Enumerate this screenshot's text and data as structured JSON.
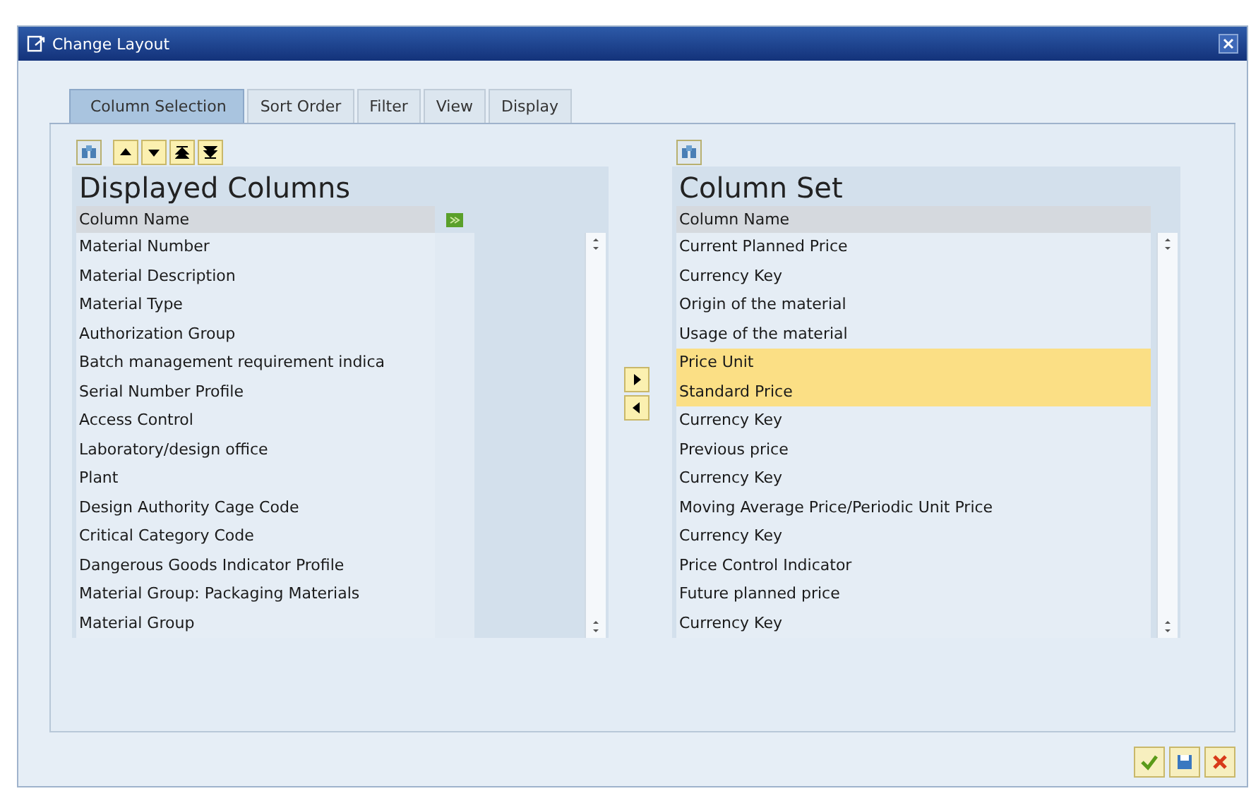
{
  "window": {
    "title": "Change Layout"
  },
  "tabs": [
    {
      "label": "Column Selection",
      "selected": true
    },
    {
      "label": "Sort Order",
      "selected": false
    },
    {
      "label": "Filter",
      "selected": false
    },
    {
      "label": "View",
      "selected": false
    },
    {
      "label": "Display",
      "selected": false
    }
  ],
  "displayed_columns": {
    "title": "Displayed Columns",
    "column_header": "Column Name",
    "rows": [
      {
        "label": "Material Number",
        "selected": false
      },
      {
        "label": "Material Description",
        "selected": false
      },
      {
        "label": "Material Type",
        "selected": false
      },
      {
        "label": "Authorization Group",
        "selected": false
      },
      {
        "label": "Batch management requirement indica",
        "selected": false
      },
      {
        "label": "Serial Number Profile",
        "selected": false
      },
      {
        "label": "Access Control",
        "selected": false
      },
      {
        "label": "Laboratory/design office",
        "selected": false
      },
      {
        "label": "Plant",
        "selected": false
      },
      {
        "label": "Design Authority Cage Code",
        "selected": false
      },
      {
        "label": "Critical Category Code",
        "selected": false
      },
      {
        "label": "Dangerous Goods Indicator Profile",
        "selected": false
      },
      {
        "label": "Material Group: Packaging Materials",
        "selected": false
      },
      {
        "label": "Material Group",
        "selected": false
      }
    ]
  },
  "column_set": {
    "title": "Column Set",
    "column_header": "Column Name",
    "rows": [
      {
        "label": "Current Planned Price",
        "selected": false
      },
      {
        "label": "Currency Key",
        "selected": false
      },
      {
        "label": "Origin of the material",
        "selected": false
      },
      {
        "label": "Usage of the material",
        "selected": false
      },
      {
        "label": "Price Unit",
        "selected": true
      },
      {
        "label": "Standard Price",
        "selected": true
      },
      {
        "label": "Currency Key",
        "selected": false
      },
      {
        "label": "Previous price",
        "selected": false
      },
      {
        "label": "Currency Key",
        "selected": false
      },
      {
        "label": "Moving Average Price/Periodic Unit Price",
        "selected": false
      },
      {
        "label": "Currency Key",
        "selected": false
      },
      {
        "label": "Price Control Indicator",
        "selected": false
      },
      {
        "label": "Future planned price",
        "selected": false
      },
      {
        "label": "Currency Key",
        "selected": false
      }
    ]
  }
}
